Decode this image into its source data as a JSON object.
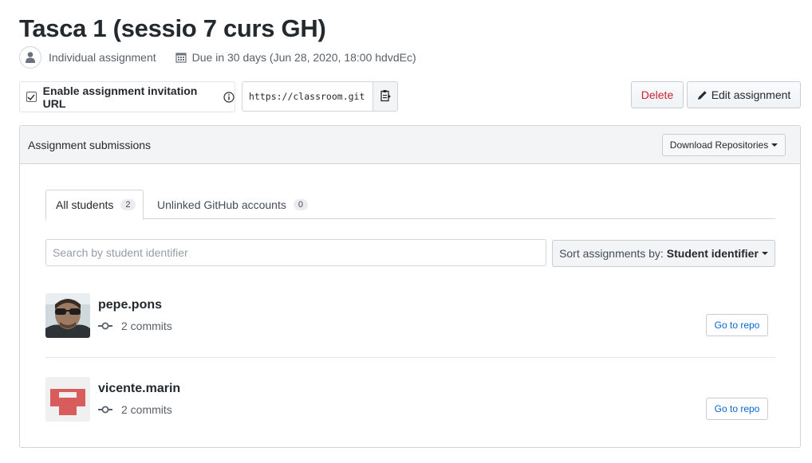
{
  "header": {
    "title": "Tasca 1 (sessio 7 curs GH)",
    "assignment_type": "Individual assignment",
    "due": "Due in 30 days (Jun 28, 2020, 18:00 hdvdEc)"
  },
  "invitation": {
    "label": "Enable assignment invitation URL",
    "checked": true,
    "url": "https://classroom.git"
  },
  "actions": {
    "delete_label": "Delete",
    "edit_label": "Edit assignment"
  },
  "submissions": {
    "heading": "Assignment submissions",
    "download_label": "Download Repositories",
    "tabs": [
      {
        "label": "All students",
        "count": "2",
        "active": true
      },
      {
        "label": "Unlinked GitHub accounts",
        "count": "0",
        "active": false
      }
    ],
    "search_placeholder": "Search by student identifier",
    "sort_prefix": "Sort assignments by:",
    "sort_value": "Student identifier",
    "students": [
      {
        "username": "pepe.pons",
        "commits": "2 commits",
        "button": "Go to repo",
        "avatar": "photo-icon"
      },
      {
        "username": "vicente.marin",
        "commits": "2 commits",
        "button": "Go to repo",
        "avatar": "identicon-icon"
      }
    ]
  },
  "colors": {
    "danger": "#cb2431",
    "link": "#0366d6",
    "identicon": "#d95c5c"
  }
}
